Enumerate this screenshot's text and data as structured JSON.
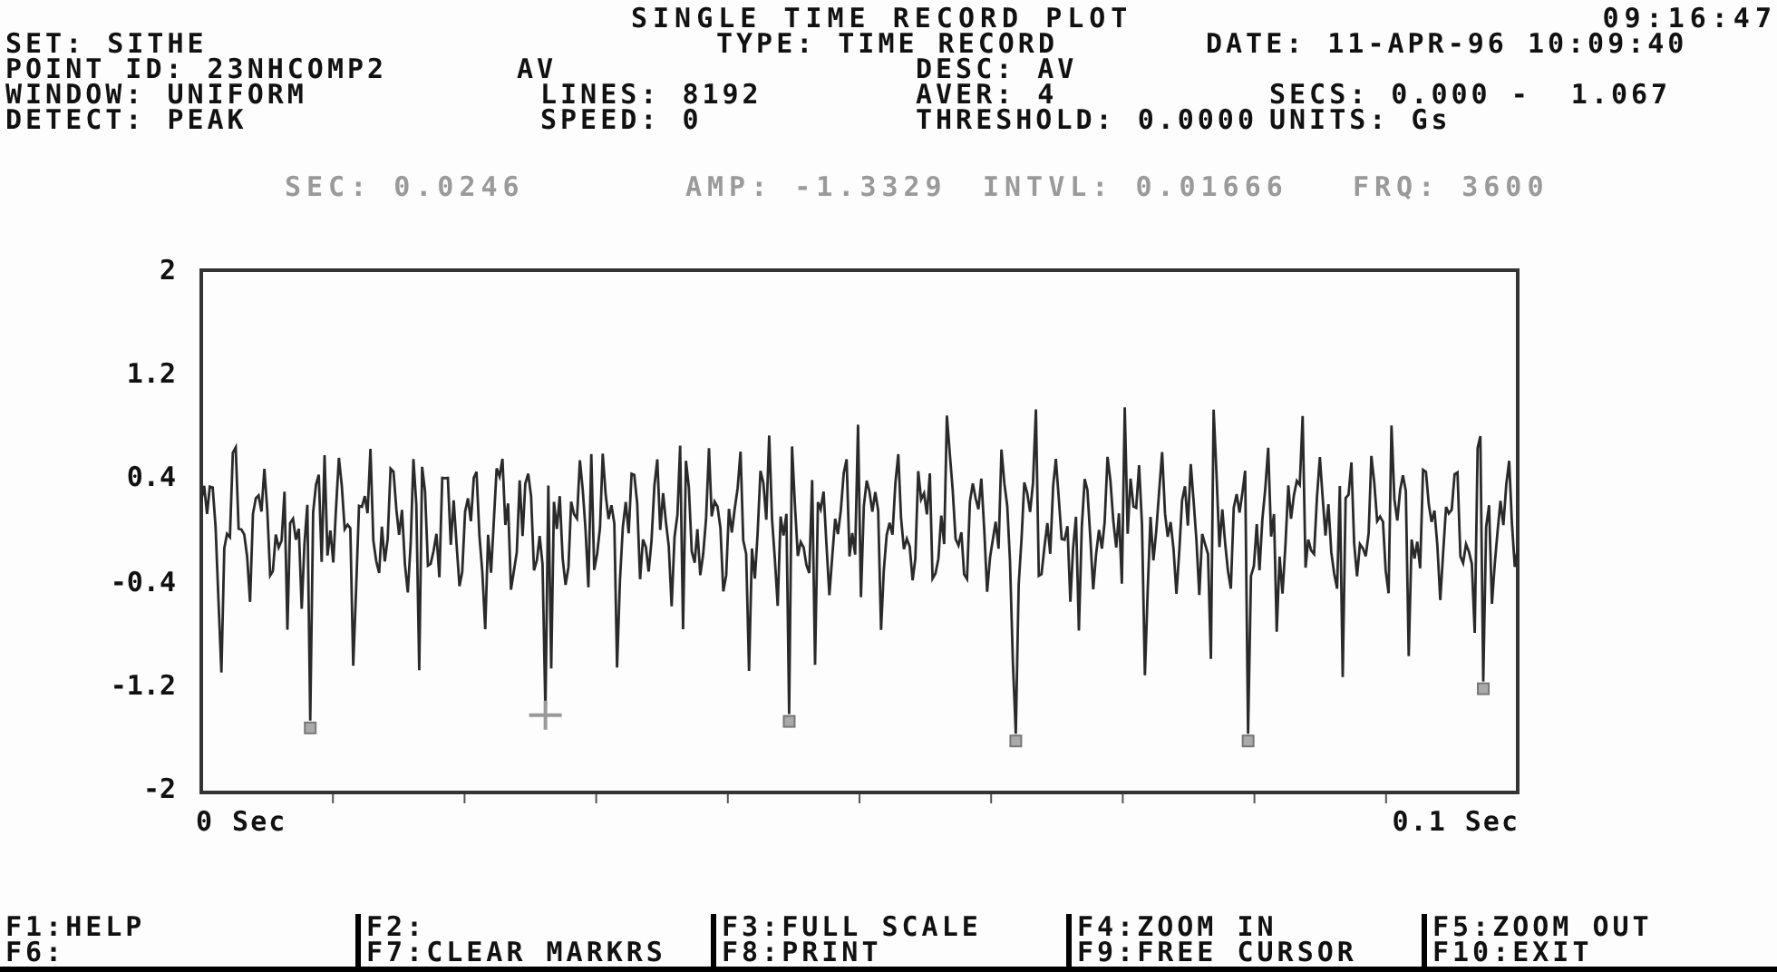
{
  "title": "SINGLE TIME RECORD PLOT",
  "clock": "09:16:47",
  "info_rows": [
    [
      {
        "label": "SET:",
        "value": "SITHE"
      },
      {
        "label": "TYPE:",
        "value": "TIME RECORD"
      },
      {
        "label": "DATE:",
        "value": "11-APR-96 10:09:40"
      }
    ],
    [
      {
        "label": "POINT ID:",
        "value": "23NHCOMP2"
      },
      {
        "value": "AV"
      },
      {
        "label": "DESC:",
        "value": "AV"
      }
    ],
    [
      {
        "label": "WINDOW:",
        "value": "UNIFORM"
      },
      {
        "label": "LINES:",
        "value": "8192"
      },
      {
        "label": "AVER:",
        "value": "4"
      },
      {
        "label": "SECS:",
        "value": "0.000 -  1.067"
      }
    ],
    [
      {
        "label": "DETECT:",
        "value": "PEAK"
      },
      {
        "label": "SPEED:",
        "value": "0"
      },
      {
        "label": "THRESHOLD:",
        "value": "0.0000"
      },
      {
        "label": "UNITS:",
        "value": "Gs"
      }
    ]
  ],
  "cursor_readout": [
    {
      "label": "SEC:",
      "value": "0.0246"
    },
    {
      "label": "AMP:",
      "value": "-1.3329"
    },
    {
      "label": "INTVL:",
      "value": "0.01666"
    },
    {
      "label": "FRQ:",
      "value": "3600"
    }
  ],
  "plot": {
    "y_labels": [
      "2",
      "1.2",
      "0.4",
      "-0.4",
      "-1.2",
      "-2"
    ],
    "x_start": "0 Sec",
    "x_end": "0.1 Sec"
  },
  "function_keys": [
    {
      "top": "F1:HELP",
      "bottom": "F6:"
    },
    {
      "top": "F2:",
      "bottom": "F7:CLEAR MARKRS"
    },
    {
      "top": "F3:FULL SCALE",
      "bottom": "F8:PRINT"
    },
    {
      "top": "F4:ZOOM IN",
      "bottom": "F9:FREE CURSOR"
    },
    {
      "top": "F5:ZOOM OUT",
      "bottom": "F10:EXIT"
    }
  ]
}
